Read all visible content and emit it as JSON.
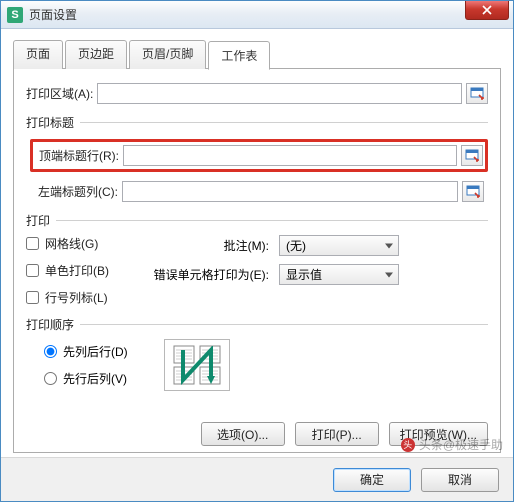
{
  "title": "页面设置",
  "app_icon_letter": "S",
  "tabs": {
    "t0": "页面",
    "t1": "页边距",
    "t2": "页眉/页脚",
    "t3": "工作表"
  },
  "print_area": {
    "label": "打印区域(A):",
    "value": ""
  },
  "print_titles": {
    "header": "打印标题",
    "top_rows": {
      "label": "顶端标题行(R):",
      "value": ""
    },
    "left_cols": {
      "label": "左端标题列(C):",
      "value": ""
    }
  },
  "print_section": {
    "header": "打印",
    "gridlines": "网格线(G)",
    "monochrome": "单色打印(B)",
    "rowcol_headers": "行号列标(L)",
    "comments_label": "批注(M):",
    "comments_value": "(无)",
    "errors_label": "错误单元格打印为(E):",
    "errors_value": "显示值"
  },
  "order_section": {
    "header": "打印顺序",
    "down_then_over": "先列后行(D)",
    "over_then_down": "先行后列(V)"
  },
  "buttons": {
    "options": "选项(O)...",
    "print": "打印(P)...",
    "preview": "打印预览(W)..."
  },
  "footer": {
    "ok": "确定",
    "cancel": "取消"
  },
  "watermark": "头条@极速手助"
}
